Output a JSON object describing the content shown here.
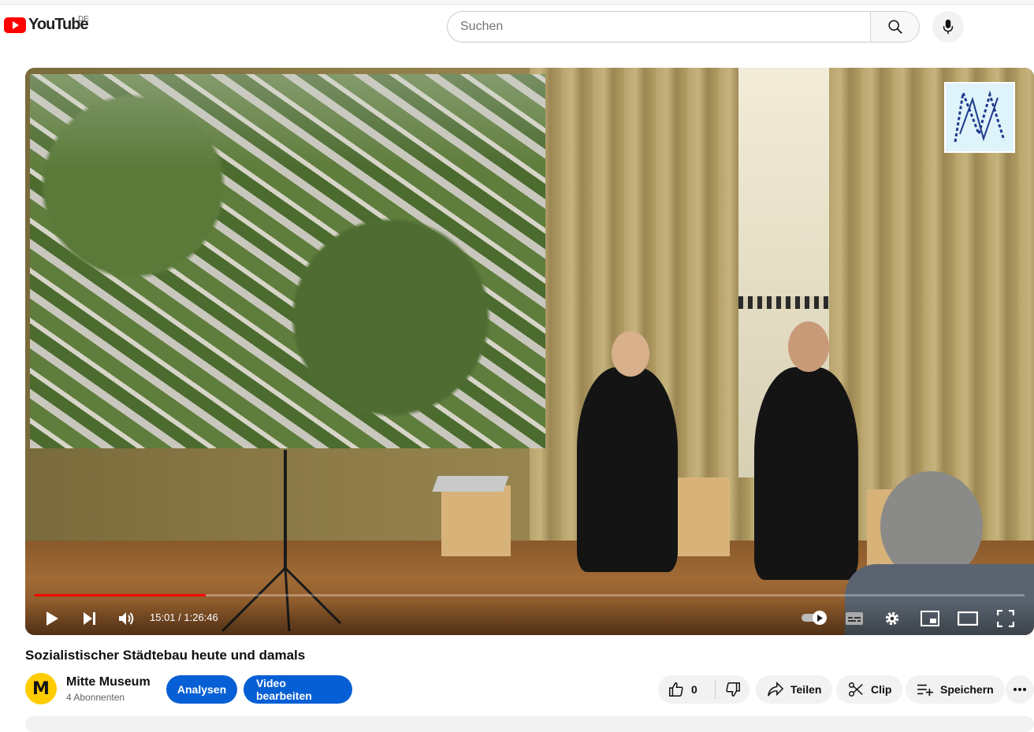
{
  "header": {
    "logo_text": "YouTube",
    "country_code": "DE",
    "search_placeholder": "Suchen"
  },
  "player": {
    "current_time": "15:01",
    "duration": "1:26:46",
    "time_display": "15:01 / 1:26:46",
    "progress_fraction": 0.173,
    "autoplay_on": true
  },
  "video": {
    "title": "Sozialistischer Städtebau heute und damals"
  },
  "channel": {
    "avatar_letter": "M",
    "name": "Mitte Museum",
    "subscribers": "4 Abonnenten"
  },
  "actions": {
    "analytics_label": "Analysen",
    "edit_label": "Video bearbeiten",
    "like_count": "0",
    "share_label": "Teilen",
    "clip_label": "Clip",
    "save_label": "Speichern"
  },
  "colors": {
    "brand_red": "#ff0000",
    "accent_blue": "#065fd4"
  }
}
